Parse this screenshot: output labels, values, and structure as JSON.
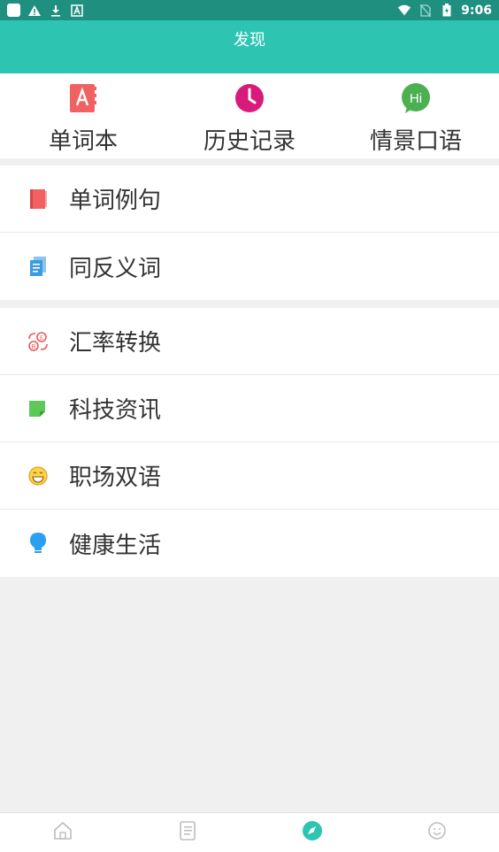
{
  "status_bar": {
    "time": "9:06",
    "left_icons": [
      "app-square-icon",
      "warning-icon",
      "download-icon",
      "a-icon"
    ],
    "right_icons": [
      "wifi-icon",
      "no-sim-icon",
      "battery-icon"
    ]
  },
  "header": {
    "title": "发现"
  },
  "quick": [
    {
      "label": "单词本",
      "icon": "wordbook-icon"
    },
    {
      "label": "历史记录",
      "icon": "history-icon"
    },
    {
      "label": "情景口语",
      "icon": "hi-chat-icon"
    }
  ],
  "section1": [
    {
      "label": "单词例句",
      "icon": "book-icon"
    },
    {
      "label": "同反义词",
      "icon": "documents-icon"
    }
  ],
  "section2": [
    {
      "label": "汇率转换",
      "icon": "currency-exchange-icon"
    },
    {
      "label": "科技资讯",
      "icon": "note-icon"
    },
    {
      "label": "职场双语",
      "icon": "smile-icon"
    },
    {
      "label": "健康生活",
      "icon": "lightbulb-icon"
    }
  ],
  "tabbar": {
    "tabs": [
      {
        "icon": "home-icon"
      },
      {
        "icon": "notebook-icon"
      },
      {
        "icon": "compass-icon",
        "active": true
      },
      {
        "icon": "profile-icon"
      }
    ],
    "active_color": "#2dc5b2"
  },
  "colors": {
    "primary": "#2dc5b2",
    "status_bar": "#1f8f80",
    "wordbook": "#f06262",
    "history": "#d81b7a",
    "hi": "#4caf50"
  }
}
